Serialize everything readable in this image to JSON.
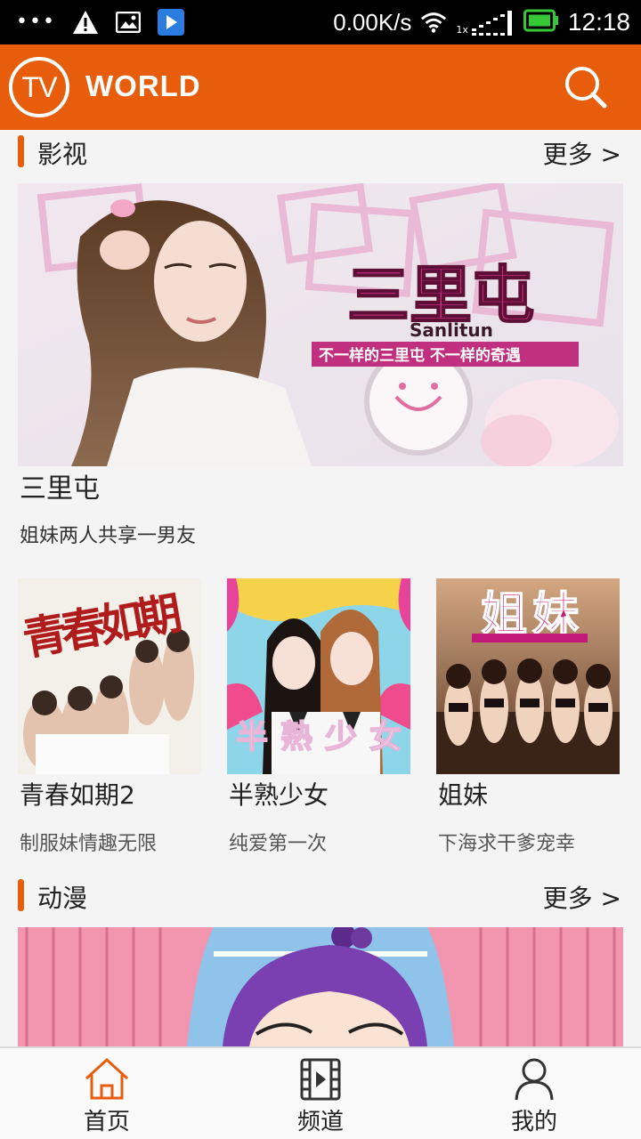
{
  "status_bar": {
    "net_speed": "0.00K/s",
    "time": "12:18",
    "icons": [
      "more-dots-icon",
      "warning-icon",
      "image-icon",
      "play-store-icon",
      "wifi-icon",
      "signal-icon",
      "battery-icon"
    ]
  },
  "header": {
    "logo_mark": "TV",
    "logo_text": "WORLD",
    "search_icon": "search-icon",
    "accent_color": "#e85d0c"
  },
  "sections": {
    "film": {
      "title": "影视",
      "more": "更多 >",
      "feature": {
        "title": "三里屯",
        "subtitle": "姐妹两人共享一男友",
        "poster_logo": "三里屯",
        "poster_logo_en": "Sanlitun",
        "poster_tagline": "不一样的三里屯 不一样的奇遇"
      },
      "items": [
        {
          "title": "青春如期2",
          "subtitle": "制服妹情趣无限",
          "poster_text": "青春如期"
        },
        {
          "title": "半熟少女",
          "subtitle": "纯爱第一次",
          "poster_text": "半熟少女"
        },
        {
          "title": "姐妹",
          "subtitle": "下海求干爹宠幸",
          "poster_text": "姐妹"
        }
      ]
    },
    "anime": {
      "title": "动漫",
      "more": "更多 >"
    }
  },
  "bottom_nav": [
    {
      "label": "首页",
      "icon": "home-icon",
      "active": true
    },
    {
      "label": "频道",
      "icon": "film-icon",
      "active": false
    },
    {
      "label": "我的",
      "icon": "user-icon",
      "active": false
    }
  ]
}
